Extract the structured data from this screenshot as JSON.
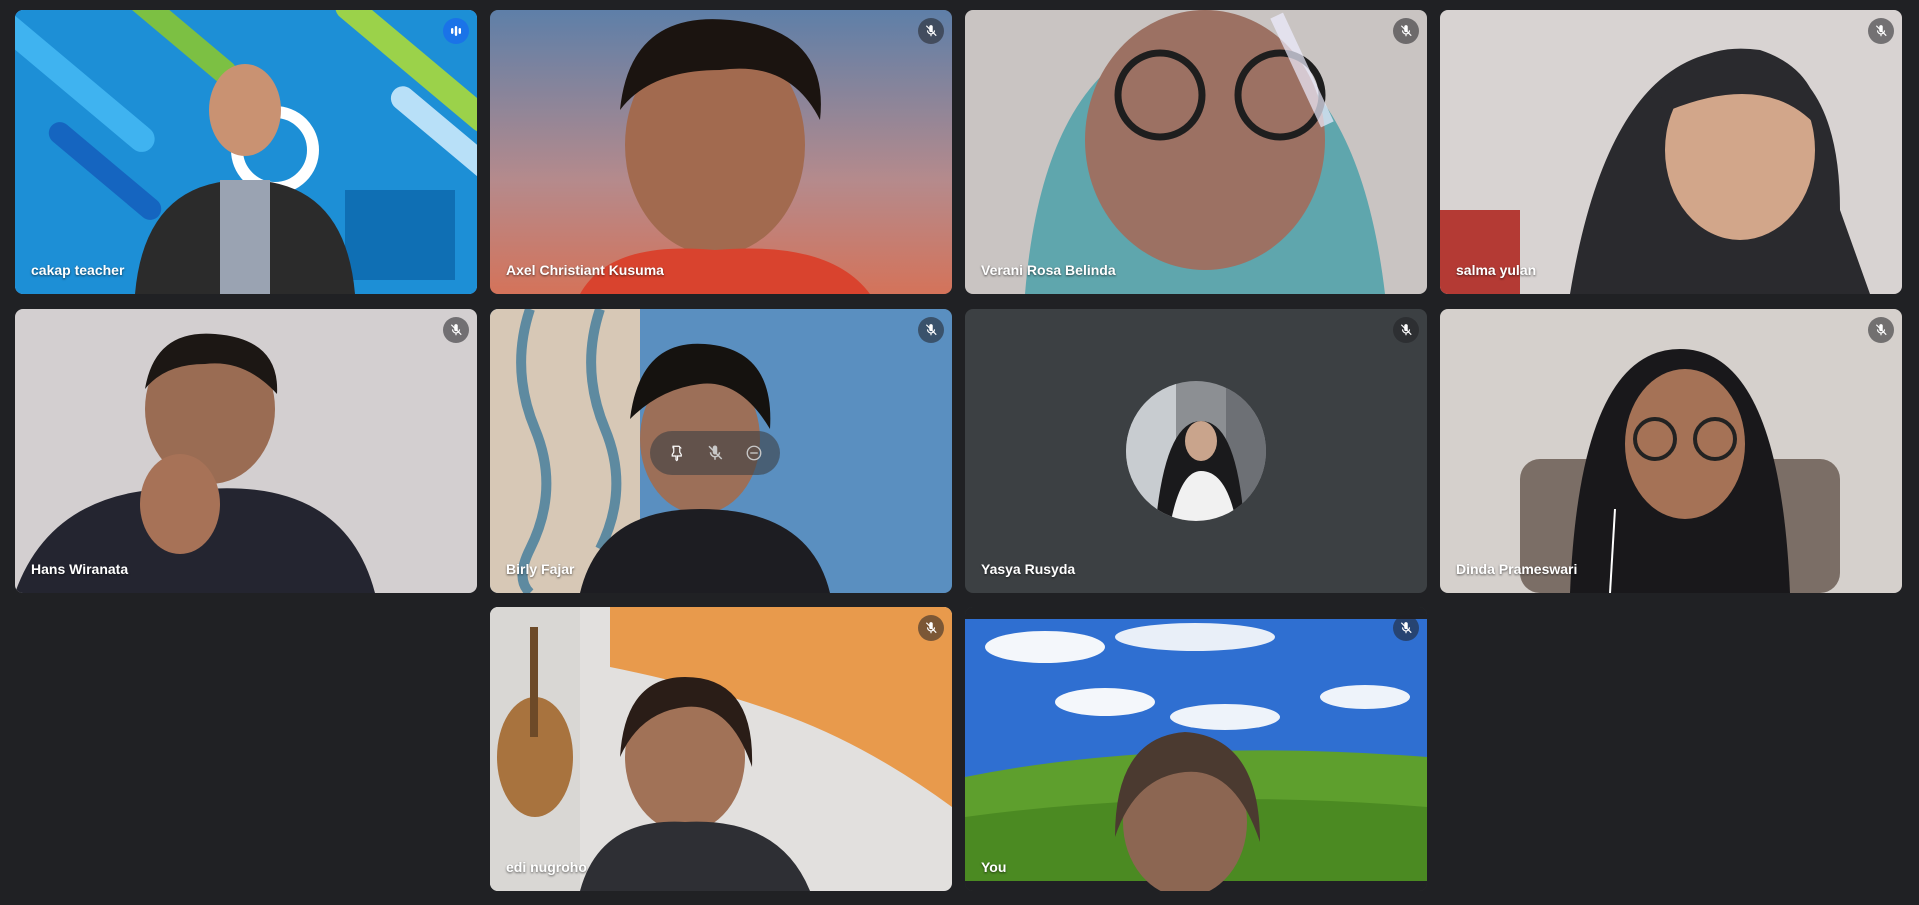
{
  "participants": [
    {
      "name": "cakap teacher",
      "status": "speaking"
    },
    {
      "name": "Axel Christiant Kusuma",
      "status": "muted"
    },
    {
      "name": "Verani Rosa Belinda",
      "status": "muted"
    },
    {
      "name": "salma yulan",
      "status": "muted"
    },
    {
      "name": "Hans Wiranata",
      "status": "muted"
    },
    {
      "name": "Birly Fajar",
      "status": "muted"
    },
    {
      "name": "Yasya Rusyda",
      "status": "muted",
      "camera": "off"
    },
    {
      "name": "Dinda Prameswari",
      "status": "muted"
    },
    {
      "name": "edi nugroho",
      "status": "muted"
    },
    {
      "name": "You",
      "status": "muted"
    }
  ],
  "icons": {
    "muted": "mic-off-icon",
    "speaking": "audio-level-icon",
    "pin": "pin-icon",
    "mute_participant": "mic-off-icon",
    "remove": "remove-icon"
  },
  "colors": {
    "background": "#202124",
    "tile_off": "#3c4043",
    "speaking_border": "#8ab4f8",
    "speaking_badge": "#1a73e8"
  }
}
